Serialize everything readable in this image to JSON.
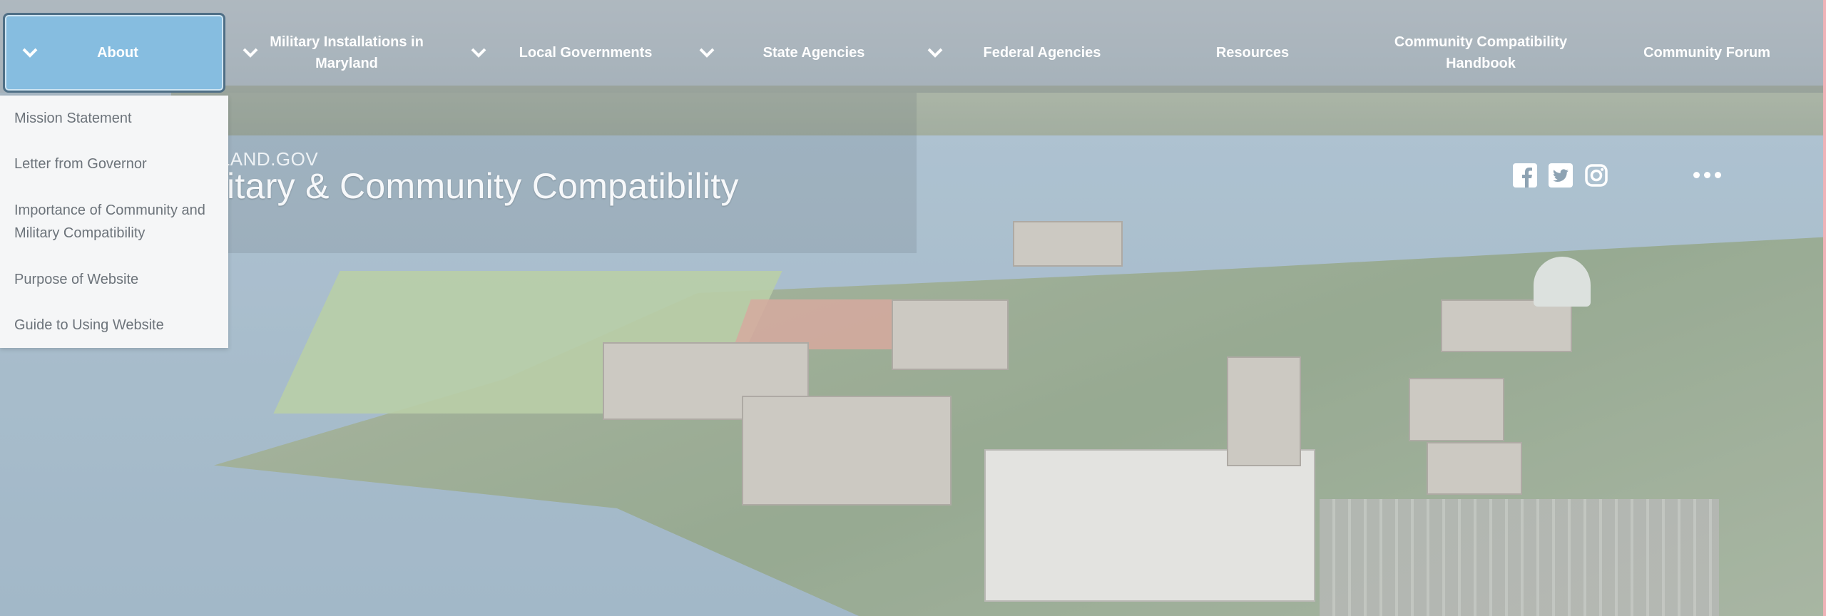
{
  "nav": {
    "items": [
      {
        "label": "About",
        "has_dropdown": true,
        "active": true
      },
      {
        "label": "Military Installations in Maryland",
        "has_dropdown": true
      },
      {
        "label": "Local Governments",
        "has_dropdown": true
      },
      {
        "label": "State Agencies",
        "has_dropdown": true
      },
      {
        "label": "Federal Agencies",
        "has_dropdown": true
      },
      {
        "label": "Resources",
        "has_dropdown": false
      },
      {
        "label": "Community Compatibility Handbook",
        "has_dropdown": false
      },
      {
        "label": "Community Forum",
        "has_dropdown": false
      }
    ]
  },
  "dropdown": {
    "items": [
      {
        "label": "Mission Statement"
      },
      {
        "label": "Letter from Governor"
      },
      {
        "label": "Importance of Community and Military Compatibility"
      },
      {
        "label": "Purpose of Website"
      },
      {
        "label": "Guide to Using Website"
      }
    ]
  },
  "header": {
    "site_small": "YLAND.GOV",
    "title": "itary & Community Compatibility"
  },
  "social": {
    "icons": [
      "facebook-icon",
      "twitter-icon",
      "instagram-icon"
    ],
    "more_icon": "more-icon"
  },
  "colors": {
    "active_nav_bg": "#86bde0",
    "dropdown_bg": "#f5f6f7",
    "nav_text": "#ffffff"
  }
}
